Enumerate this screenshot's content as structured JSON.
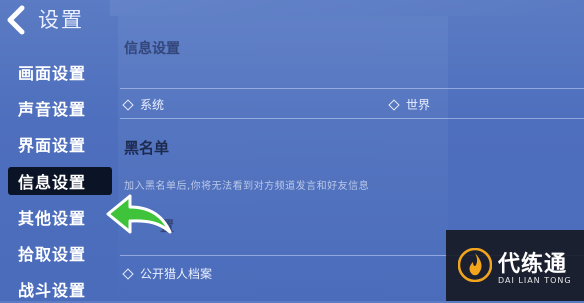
{
  "header": {
    "title": "设置",
    "back_icon": "chevron-left-icon"
  },
  "sidebar": {
    "items": [
      {
        "label": "画面设置",
        "active": false
      },
      {
        "label": "声音设置",
        "active": false
      },
      {
        "label": "界面设置",
        "active": false
      },
      {
        "label": "信息设置",
        "active": true
      },
      {
        "label": "其他设置",
        "active": false
      },
      {
        "label": "拾取设置",
        "active": false
      },
      {
        "label": "战斗设置",
        "active": false
      }
    ]
  },
  "content": {
    "info_section_title": "信息设置",
    "info_options": [
      {
        "label": "系统"
      },
      {
        "label": "世界"
      }
    ],
    "blacklist_title": "黑名单",
    "blacklist_desc": "加入黑名单后,你将无法看到对方频道发言和好友信息",
    "hidden_section_title": "置",
    "profile_option": "公开猎人档案"
  },
  "watermark": {
    "name_cn": "代练通",
    "name_en": "DAI LIAN TONG"
  },
  "colors": {
    "accent_arrow": "#3ec33a",
    "active_bg": "#0b1326",
    "logo_flame": "#f2a51c"
  }
}
